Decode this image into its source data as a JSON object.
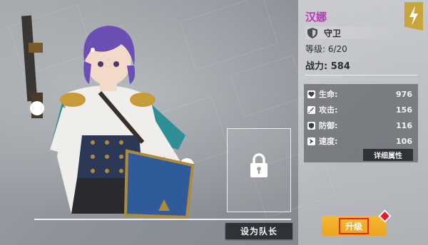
{
  "hero": {
    "name": "汉娜",
    "role": "守卫",
    "level": "等级: 6/20",
    "power": "战力: 584"
  },
  "stats": [
    {
      "icon": "heart-icon",
      "label": "生命:",
      "value": "976"
    },
    {
      "icon": "sword-icon",
      "label": "攻击:",
      "value": "156"
    },
    {
      "icon": "shield-small-icon",
      "label": "防御:",
      "value": "116"
    },
    {
      "icon": "speed-icon",
      "label": "速度:",
      "value": "106"
    }
  ],
  "buttons": {
    "detail": "详细属性",
    "set_leader": "设为队长",
    "upgrade": "升级"
  },
  "colors": {
    "name": "#c233b8",
    "upgrade": "#f2b02a",
    "badge": "#c9a43a",
    "alert": "#e51e2b"
  }
}
